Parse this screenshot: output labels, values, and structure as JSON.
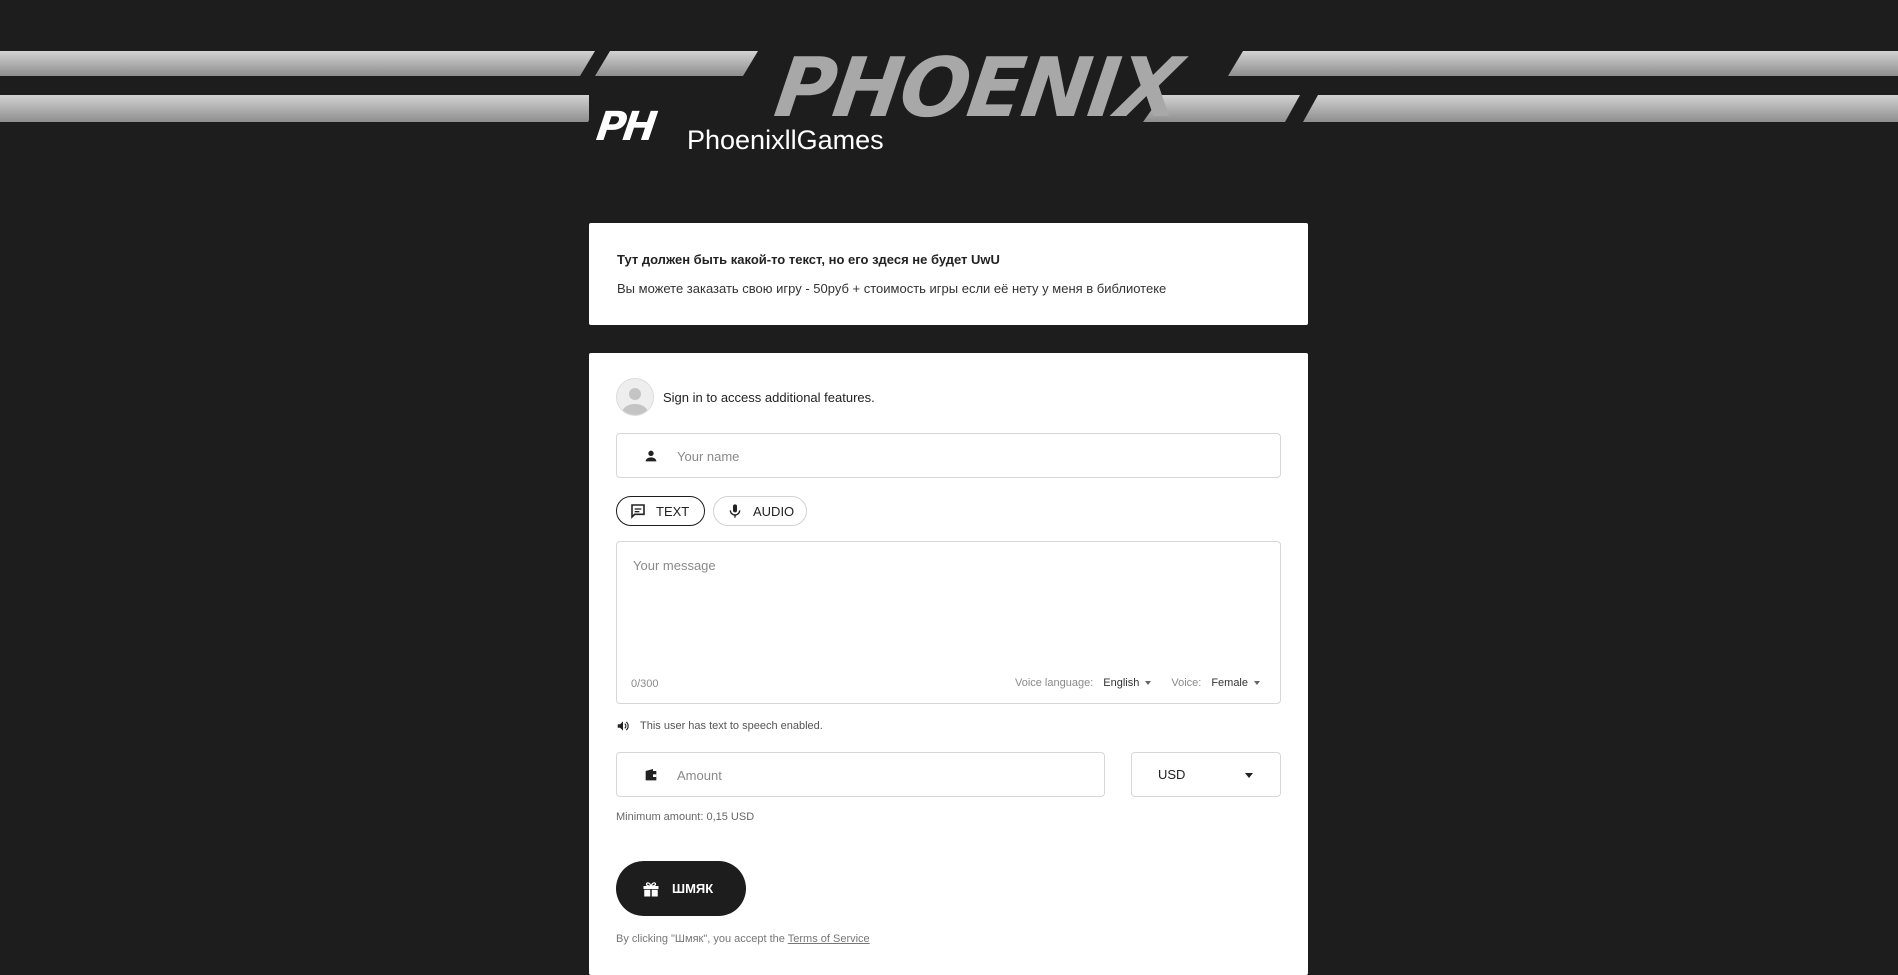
{
  "banner": {
    "logo_text": "PHOENIX",
    "avatar_text": "PH",
    "channel_name": "PhoenixllGames"
  },
  "info": {
    "title": "Тут должен быть какой-то текст, но его здеся не будет UwU",
    "description": "Вы можете заказать свою игру - 50руб + стоимость игры если её нету у меня в библиотеке"
  },
  "signin": {
    "link_label": "Sign in",
    "rest_text": " to access additional features."
  },
  "form": {
    "name_placeholder": "Your name",
    "mode_text_label": "TEXT",
    "mode_audio_label": "AUDIO",
    "message_placeholder": "Your message",
    "counter": "0/300",
    "voice_language_label": "Voice language:",
    "voice_language_value": "English",
    "voice_label": "Voice:",
    "voice_value": "Female",
    "tts_notice": "This user has text to speech enabled.",
    "amount_placeholder": "Amount",
    "currency": "USD",
    "min_amount": "Minimum amount: 0,15 USD",
    "donate_label": "ШМЯК",
    "tos_prefix": "By clicking \"Шмяк\", you accept the ",
    "tos_link": "Terms of Service"
  },
  "colors": {
    "background": "#1d1d1e",
    "card": "#ffffff",
    "accent": "#1d1d1e"
  },
  "icons": {
    "name_icon": "person-icon",
    "text_mode_icon": "chat-icon",
    "audio_mode_icon": "microphone-icon",
    "tts_icon": "speaker-icon",
    "amount_icon": "wallet-icon",
    "donate_icon": "gift-icon"
  }
}
